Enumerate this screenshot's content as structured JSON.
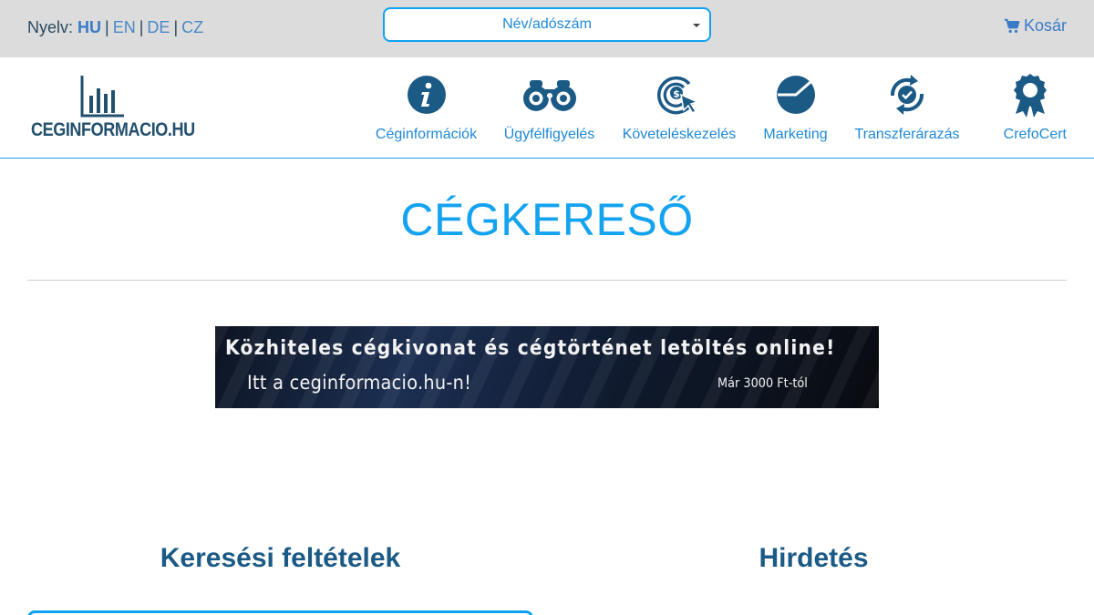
{
  "topbar": {
    "language_label": "Nyelv:",
    "languages": [
      {
        "code": "HU",
        "active": true
      },
      {
        "code": "EN",
        "active": false
      },
      {
        "code": "DE",
        "active": false
      },
      {
        "code": "CZ",
        "active": false
      }
    ],
    "separator": "|",
    "search_select": {
      "selected": "Név/adószám"
    },
    "cart_label": "Kosár"
  },
  "logo": {
    "text": "CEGINFORMACIO.HU"
  },
  "nav": {
    "items": [
      {
        "label": "Céginformációk",
        "icon": "info-icon"
      },
      {
        "label": "Ügyfélfigyelés",
        "icon": "binoculars-icon"
      },
      {
        "label": "Követeléskezelés",
        "icon": "target-dollar-icon"
      },
      {
        "label": "Marketing",
        "icon": "pie-chart-icon"
      },
      {
        "label": "Transzferárazás",
        "icon": "refresh-check-icon"
      },
      {
        "label": "CrefoCert",
        "icon": "award-icon"
      }
    ]
  },
  "page": {
    "title": "CÉGKERESŐ"
  },
  "banner": {
    "headline": "Közhiteles cégkivonat és cégtörténet letöltés online!",
    "subline": "Itt a ceginformacio.hu-n!",
    "price": "Már 3000 Ft-tól"
  },
  "sections": {
    "search_criteria": "Keresési feltételek",
    "ads": "Hirdetés"
  },
  "colors": {
    "accent": "#10a1f0",
    "nav_text": "#1e88d6",
    "icon_dark": "#1c5a86",
    "heading": "#1c5a86",
    "topbar_bg": "#dcdcdc"
  }
}
